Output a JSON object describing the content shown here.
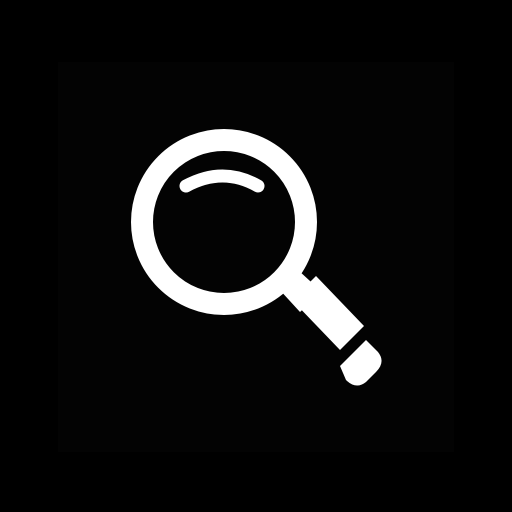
{
  "icon": {
    "name": "magnifying-glass-icon",
    "color": "#ffffff",
    "background": "#000000"
  }
}
